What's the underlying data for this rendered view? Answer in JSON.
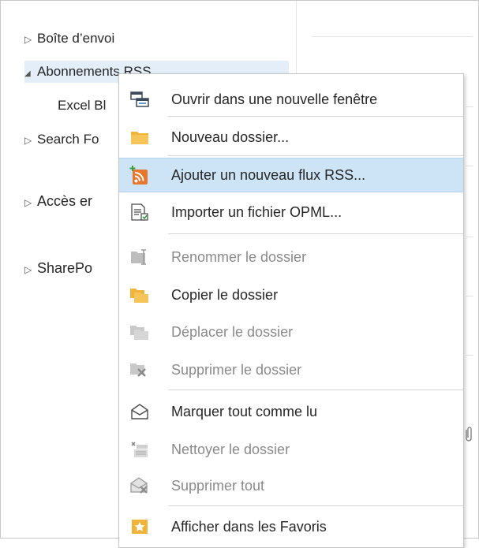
{
  "folder_pane": {
    "items": [
      {
        "label": "Boîte d’envoi",
        "expander": "▷"
      },
      {
        "label": "Abonnements RSS",
        "expander": "◢"
      },
      {
        "label": "Excel Bl",
        "expander": ""
      },
      {
        "label": "Search Fo",
        "expander": "▷"
      },
      {
        "label": "Accès er",
        "expander": "▷"
      },
      {
        "label": "SharePo",
        "expander": "▷"
      }
    ]
  },
  "context_menu": {
    "items": [
      {
        "label": "Ouvrir dans une nouvelle fenêtre",
        "icon": "new-window-icon",
        "enabled": true
      },
      {
        "label": "Nouveau dossier...",
        "icon": "folder-icon",
        "enabled": true
      },
      {
        "label": "Ajouter un nouveau flux RSS...",
        "icon": "rss-add-icon",
        "enabled": true,
        "highlighted": true
      },
      {
        "label": "Importer un fichier OPML...",
        "icon": "import-opml-icon",
        "enabled": true
      },
      {
        "label": "Renommer le dossier",
        "icon": "rename-folder-icon",
        "enabled": false
      },
      {
        "label": "Copier le dossier",
        "icon": "copy-folder-icon",
        "enabled": true
      },
      {
        "label": "Déplacer le dossier",
        "icon": "move-folder-icon",
        "enabled": false
      },
      {
        "label": "Supprimer le dossier",
        "icon": "delete-folder-icon",
        "enabled": false
      },
      {
        "label": "Marquer tout comme lu",
        "icon": "mark-read-icon",
        "enabled": true
      },
      {
        "label": "Nettoyer le dossier",
        "icon": "clean-folder-icon",
        "enabled": false
      },
      {
        "label": "Supprimer tout",
        "icon": "delete-all-icon",
        "enabled": false
      },
      {
        "label": "Afficher dans les Favoris",
        "icon": "favorites-icon",
        "enabled": true
      }
    ]
  },
  "colors": {
    "highlight": "#cde4f7",
    "folder_selected": "#e3eef9",
    "disabled_text": "#8a8a8a",
    "folder_yellow": "#f0b43a",
    "rss_orange": "#e8772e"
  }
}
